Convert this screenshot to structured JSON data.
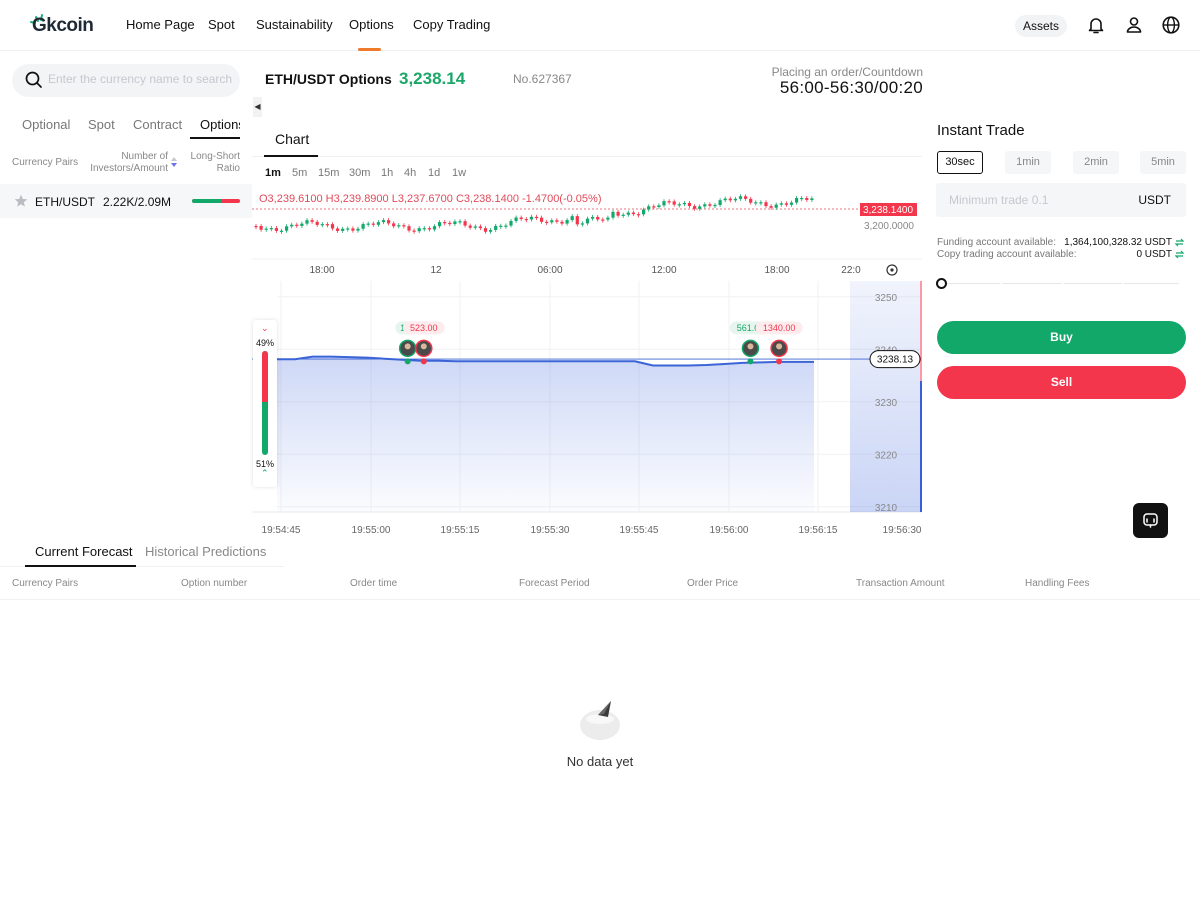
{
  "brand": {
    "name": "Gkcoin",
    "accent": "#12a86a"
  },
  "nav": {
    "items": [
      {
        "label": "Home Page"
      },
      {
        "label": "Spot"
      },
      {
        "label": "Sustainability"
      },
      {
        "label": "Options",
        "active": true
      },
      {
        "label": "Copy Trading"
      }
    ],
    "assets_label": "Assets",
    "icons": [
      "bell-icon",
      "user-icon",
      "globe-icon"
    ]
  },
  "market": {
    "search_placeholder": "Enter the currency name to search",
    "tabs": [
      {
        "label": "Optional"
      },
      {
        "label": "Spot"
      },
      {
        "label": "Contract"
      },
      {
        "label": "Options",
        "active": true
      }
    ],
    "headers": {
      "pairs": "Currency Pairs",
      "investors_line1": "Number of",
      "investors_line2": "Investors/Amount",
      "ratio_line1": "Long-Short",
      "ratio_line2": "Ratio"
    },
    "rows": [
      {
        "pair": "ETH/USDT",
        "investors": "2.22K/2.09M",
        "long_ratio": 0.62
      }
    ]
  },
  "ticker": {
    "title": "ETH/USDT Options",
    "price": "3,238.14",
    "order_no": "No.627367",
    "countdown_label": "Placing an order/Countdown",
    "countdown_value": "56:00-56:30/00:20"
  },
  "chart_tab": "Chart",
  "timeframes": [
    {
      "label": "1m",
      "active": true
    },
    {
      "label": "5m"
    },
    {
      "label": "15m"
    },
    {
      "label": "30m"
    },
    {
      "label": "1h"
    },
    {
      "label": "4h"
    },
    {
      "label": "1d"
    },
    {
      "label": "1w"
    }
  ],
  "ohlc_text": "O3,239.6100  H3,239.8900  L3,237.6700  C3,238.1400  -1.4700(-0.05%)",
  "chart_data": [
    {
      "type": "candlestick",
      "x_tick_labels": [
        "18:00",
        "12",
        "06:00",
        "12:00",
        "18:00",
        "22:0"
      ],
      "y_tick_labels": [
        "3,200.0000"
      ],
      "last_price_label": "3,238.1400"
    },
    {
      "type": "area",
      "x_tick_labels": [
        "19:54:45",
        "19:55:00",
        "19:55:15",
        "19:55:30",
        "19:55:45",
        "19:56:00",
        "19:56:15",
        "19:56:30"
      ],
      "y_tick_labels": [
        "3250",
        "3240",
        "3230",
        "3220",
        "3210"
      ],
      "ylim": [
        3209,
        3253
      ],
      "current_price_label": "3238.13",
      "series": [
        {
          "x": [
            0,
            2,
            4,
            6,
            8,
            10,
            12,
            14,
            16,
            18,
            20,
            22,
            24,
            26,
            28,
            30,
            32,
            34,
            36,
            38,
            40,
            42,
            44,
            46,
            48,
            50,
            52,
            54,
            56,
            58,
            60
          ],
          "y": [
            3238.1,
            3238.1,
            3238.6,
            3238.6,
            3238.5,
            3238.4,
            3238.2,
            3238.0,
            3237.8,
            3237.8,
            3237.7,
            3237.7,
            3237.7,
            3237.7,
            3237.7,
            3237.7,
            3237.7,
            3237.7,
            3237.7,
            3237.7,
            3237.7,
            3236.9,
            3236.9,
            3236.9,
            3237.0,
            3237.2,
            3237.4,
            3237.5,
            3237.6,
            3237.6,
            3237.6
          ]
        }
      ],
      "markers": [
        {
          "x": 14.6,
          "label": "139",
          "side": "buy"
        },
        {
          "x": 16.4,
          "label": "523.00",
          "side": "sell"
        },
        {
          "x": 52.9,
          "label": "561.00",
          "side": "buy"
        },
        {
          "x": 56.1,
          "label": "1340.00",
          "side": "sell"
        }
      ],
      "sentiment": {
        "top_label": "49%",
        "bottom_label": "51%",
        "sell_fraction": 0.49
      }
    }
  ],
  "trade": {
    "title": "Instant Trade",
    "durations": [
      {
        "label": "30sec",
        "active": true
      },
      {
        "label": "1min"
      },
      {
        "label": "2min"
      },
      {
        "label": "5min"
      }
    ],
    "amount_placeholder": "Minimum trade 0.1",
    "amount_unit": "USDT",
    "funding_label": "Funding account available:",
    "funding_value": "1,364,100,328.32 USDT",
    "copy_label": "Copy trading account available:",
    "copy_value": "0 USDT",
    "buy_label": "Buy",
    "sell_label": "Sell",
    "buy_color": "#12a86a",
    "sell_color": "#f4364c"
  },
  "bottom": {
    "tabs": [
      {
        "label": "Current Forecast",
        "active": true
      },
      {
        "label": "Historical Predictions"
      }
    ],
    "columns": [
      "Currency Pairs",
      "Option number",
      "Order time",
      "Forecast Period",
      "Order Price",
      "Transaction Amount",
      "Handling Fees"
    ],
    "empty_text": "No data yet"
  }
}
